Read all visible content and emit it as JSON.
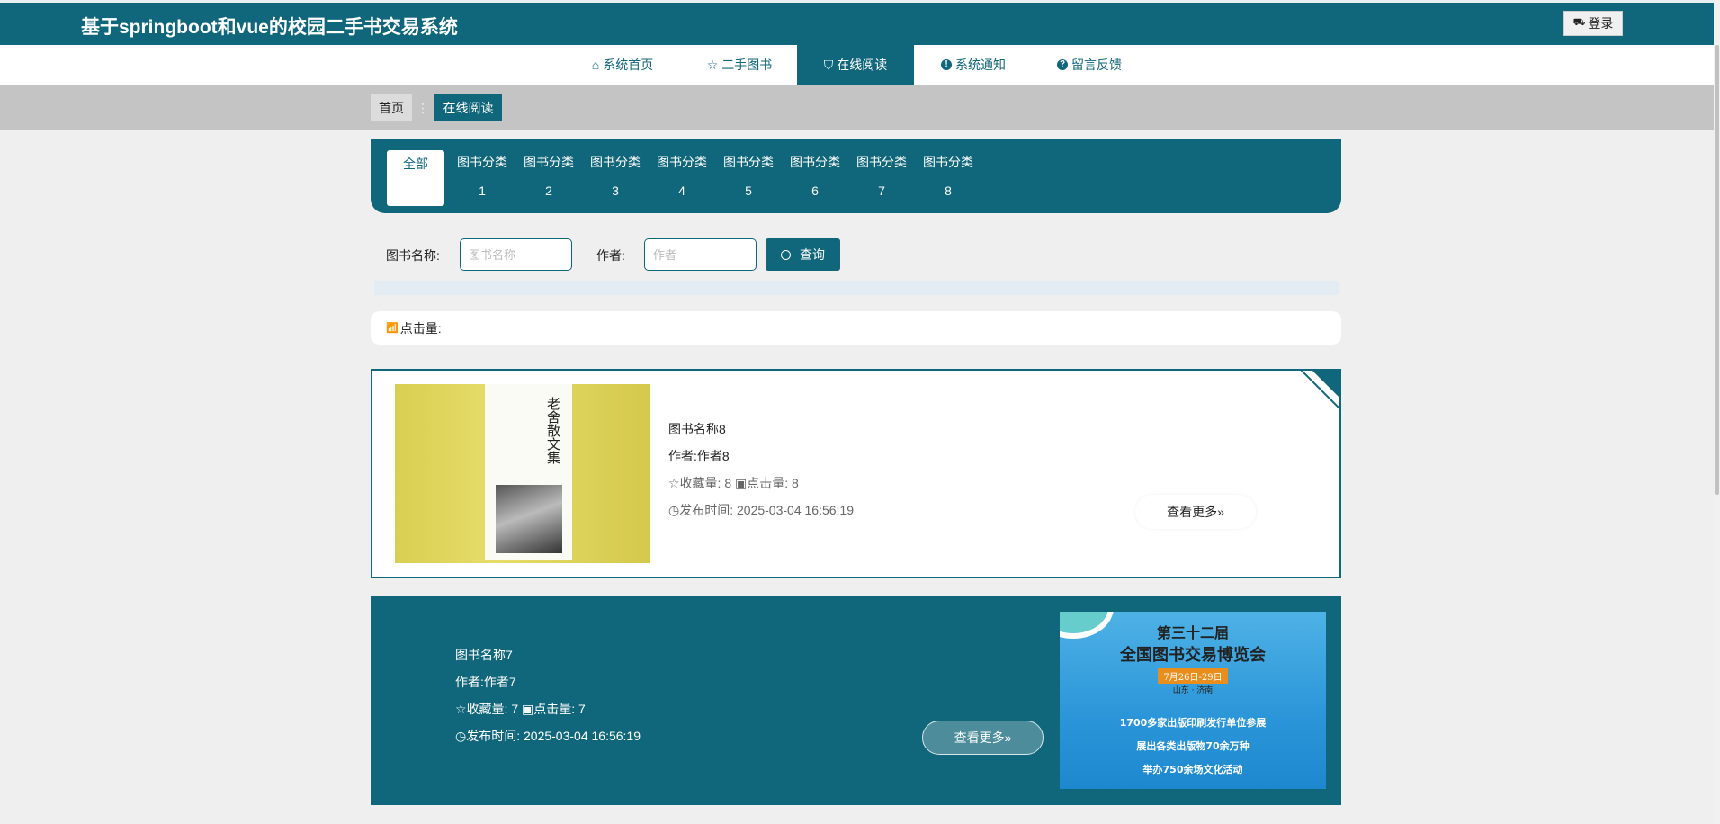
{
  "header": {
    "title": "基于springboot和vue的校园二手书交易系统",
    "login_label": "登录"
  },
  "nav": {
    "items": [
      {
        "label": "系统首页",
        "icon": "home-icon"
      },
      {
        "label": "二手图书",
        "icon": "star-icon"
      },
      {
        "label": "在线阅读",
        "icon": "bag-icon",
        "active": true
      },
      {
        "label": "系统通知",
        "icon": "info-icon"
      },
      {
        "label": "留言反馈",
        "icon": "question-icon"
      }
    ]
  },
  "breadcrumb": {
    "home": "首页",
    "separator": "⋮",
    "current": "在线阅读"
  },
  "categories": {
    "all": "全部",
    "items": [
      {
        "label": "图书分类",
        "num": "1"
      },
      {
        "label": "图书分类",
        "num": "2"
      },
      {
        "label": "图书分类",
        "num": "3"
      },
      {
        "label": "图书分类",
        "num": "4"
      },
      {
        "label": "图书分类",
        "num": "5"
      },
      {
        "label": "图书分类",
        "num": "6"
      },
      {
        "label": "图书分类",
        "num": "7"
      },
      {
        "label": "图书分类",
        "num": "8"
      }
    ]
  },
  "search": {
    "name_label": "图书名称:",
    "name_placeholder": "图书名称",
    "author_label": "作者:",
    "author_placeholder": "作者",
    "button": "查询"
  },
  "sort": {
    "label": "点击量:"
  },
  "books": [
    {
      "name": "图书名称8",
      "author": "作者:作者8",
      "fav_label": "收藏量:",
      "fav": "8",
      "click_label": "点击量:",
      "clicks": "8",
      "time_label": "发布时间:",
      "time": "2025-03-04 16:56:19",
      "more": "查看更多»",
      "cover_title": "老舍散文集"
    },
    {
      "name": "图书名称7",
      "author": "作者:作者7",
      "fav_label": "收藏量:",
      "fav": "7",
      "click_label": "点击量:",
      "clicks": "7",
      "time_label": "发布时间:",
      "time": "2025-03-04 16:56:19",
      "more": "查看更多»",
      "poster": {
        "line1": "第三十二届",
        "line2": "全国图书交易博览会",
        "date": "7月26日-29日",
        "place": "山东 · 济南",
        "stat1": "1700多家出版印刷发行单位参展",
        "stat2": "展出各类出版物70余万种",
        "stat3": "举办750余场文化活动"
      }
    }
  ],
  "colors": {
    "primary": "#10667a",
    "background": "#efefef",
    "breadcrumb_band": "#c4c4c4"
  }
}
